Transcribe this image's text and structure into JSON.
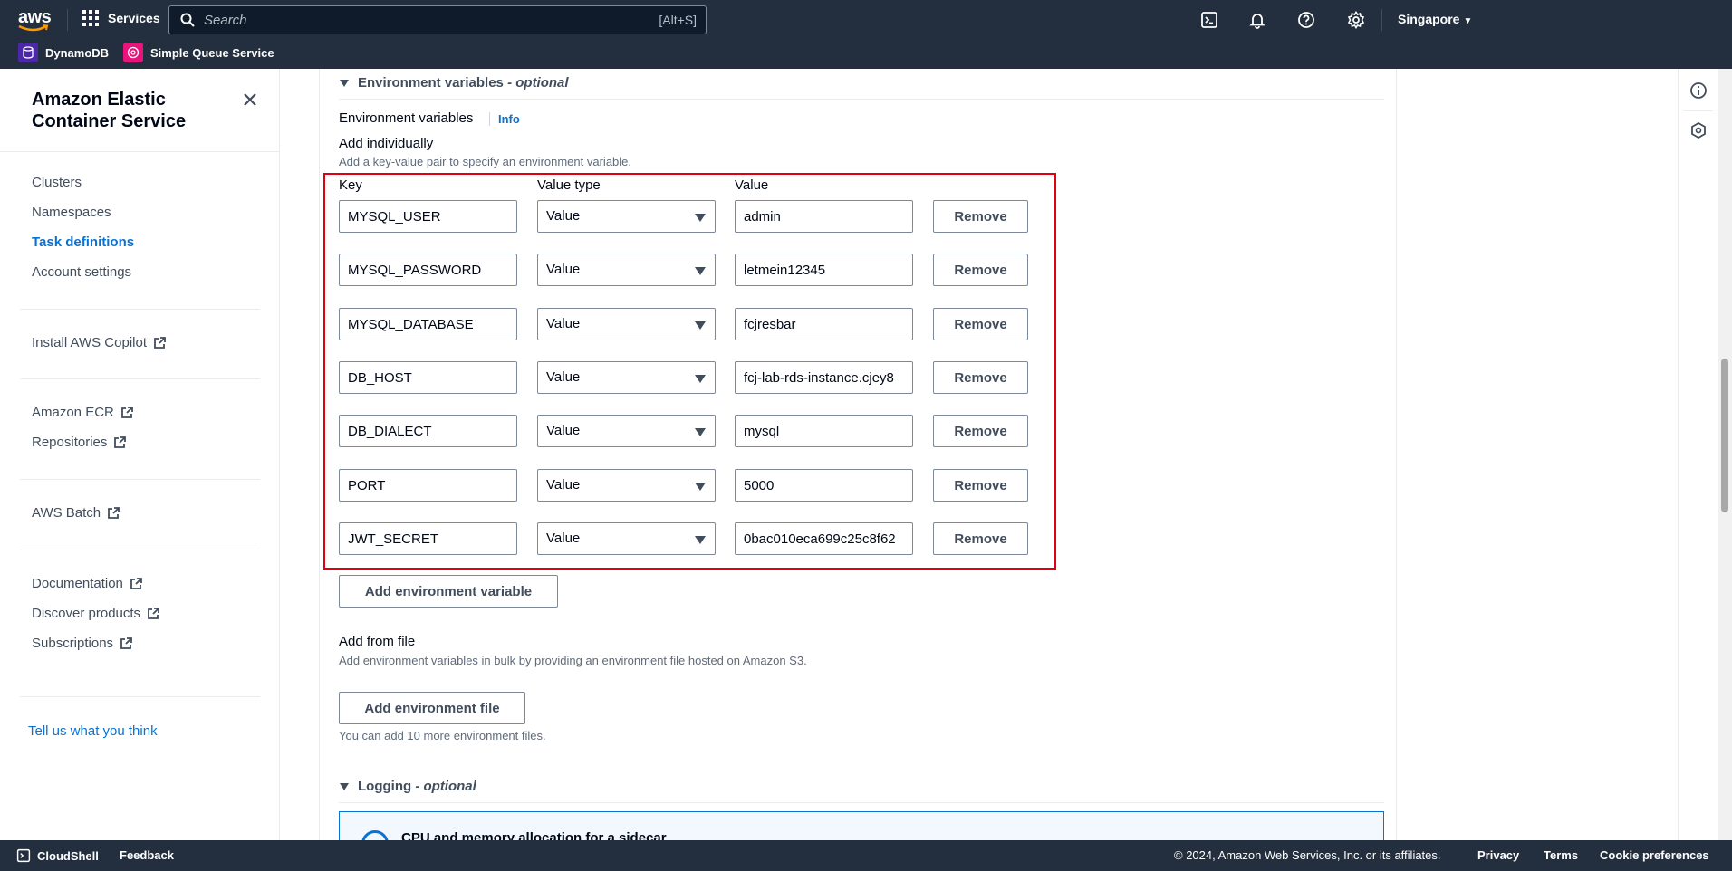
{
  "topnav": {
    "logo": "aws",
    "services_label": "Services",
    "search_placeholder": "Search",
    "search_shortcut": "[Alt+S]",
    "region": "Singapore",
    "icons": [
      "cloudshell-icon",
      "bell-icon",
      "help-icon",
      "gear-icon"
    ]
  },
  "favorites": [
    {
      "label": "DynamoDB",
      "color": "#4d27aa"
    },
    {
      "label": "Simple Queue Service",
      "color": "#e7157b"
    }
  ],
  "sidebar": {
    "title": "Amazon Elastic Container Service",
    "groups": [
      [
        {
          "label": "Clusters",
          "active": false,
          "external": false
        },
        {
          "label": "Namespaces",
          "active": false,
          "external": false
        },
        {
          "label": "Task definitions",
          "active": true,
          "external": false
        },
        {
          "label": "Account settings",
          "active": false,
          "external": false
        }
      ],
      [
        {
          "label": "Install AWS Copilot",
          "external": true
        }
      ],
      [
        {
          "label": "Amazon ECR",
          "external": true
        },
        {
          "label": "Repositories",
          "external": true
        }
      ],
      [
        {
          "label": "AWS Batch",
          "external": true
        }
      ],
      [
        {
          "label": "Documentation",
          "external": true
        },
        {
          "label": "Discover products",
          "external": true
        },
        {
          "label": "Subscriptions",
          "external": true
        }
      ]
    ],
    "feedback": "Tell us what you think"
  },
  "main": {
    "env_section_title": "Environment variables",
    "env_section_suffix": "- optional",
    "env_label": "Environment variables",
    "info": "Info",
    "add_individually": "Add individually",
    "add_individually_desc": "Add a key-value pair to specify an environment variable.",
    "columns": {
      "key": "Key",
      "value_type": "Value type",
      "value": "Value"
    },
    "env_vars": [
      {
        "key": "MYSQL_USER",
        "type": "Value",
        "value": "admin"
      },
      {
        "key": "MYSQL_PASSWORD",
        "type": "Value",
        "value": "letmein12345"
      },
      {
        "key": "MYSQL_DATABASE",
        "type": "Value",
        "value": "fcjresbar"
      },
      {
        "key": "DB_HOST",
        "type": "Value",
        "value": "fcj-lab-rds-instance.cjey8"
      },
      {
        "key": "DB_DIALECT",
        "type": "Value",
        "value": "mysql"
      },
      {
        "key": "PORT",
        "type": "Value",
        "value": "5000"
      },
      {
        "key": "JWT_SECRET",
        "type": "Value",
        "value": "0bac010eca699c25c8f62"
      }
    ],
    "remove_label": "Remove",
    "add_env_var_btn": "Add environment variable",
    "add_from_file": "Add from file",
    "add_from_file_desc": "Add environment variables in bulk by providing an environment file hosted on Amazon S3.",
    "add_env_file_btn": "Add environment file",
    "env_file_hint": "You can add 10 more environment files.",
    "logging_title": "Logging",
    "logging_suffix": "- optional",
    "infobox_title": "CPU and memory allocation for a sidecar"
  },
  "footer": {
    "cloudshell": "CloudShell",
    "feedback": "Feedback",
    "copyright": "© 2024, Amazon Web Services, Inc. or its affiliates.",
    "privacy": "Privacy",
    "terms": "Terms",
    "cookies": "Cookie preferences"
  }
}
